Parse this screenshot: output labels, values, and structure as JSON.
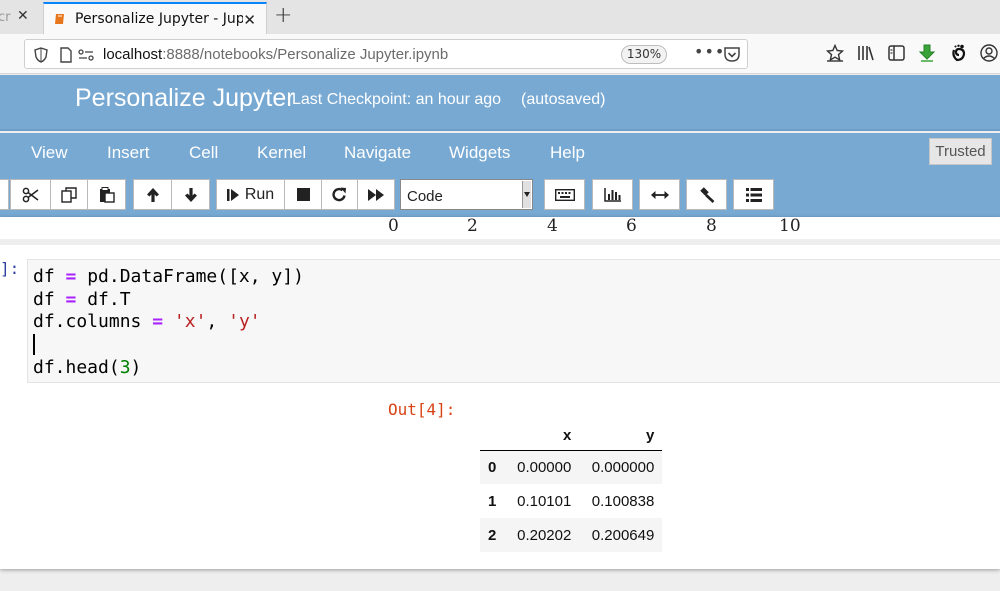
{
  "browser": {
    "prev_tab_title": "cr",
    "active_tab_title": "Personalize Jupyter - Jup",
    "url_host": "localhost",
    "url_rest": ":8888/notebooks/Personalize Jupyter.ipynb",
    "zoom": "130%",
    "dots": "•••",
    "toolbar_icons": [
      "star-icon",
      "library-icon",
      "sidebar-icon",
      "download-arrow-icon",
      "gnome-extension-icon",
      "account-icon"
    ]
  },
  "notebook": {
    "name": "Personalize Jupyter",
    "checkpoint": "Last Checkpoint: an hour ago",
    "autosave": "(autosaved)",
    "trusted": "Trusted",
    "menu": [
      "View",
      "Insert",
      "Cell",
      "Kernel",
      "Navigate",
      "Widgets",
      "Help"
    ],
    "toolbar": {
      "run_label": "Run",
      "cell_type": "Code",
      "icons": [
        "cut-icon",
        "copy-icon",
        "paste-icon",
        "move-up-icon",
        "move-down-icon",
        "run-icon",
        "stop-icon",
        "restart-icon",
        "fast-forward-icon",
        "keyboard-icon",
        "chart-icon",
        "arrows-h-icon",
        "gavel-icon",
        "list-icon"
      ]
    },
    "prev_plot_xticks": [
      "0",
      "2",
      "4",
      "6",
      "8",
      "10"
    ],
    "input_prompt": "]:",
    "output_prompt": "Out[4]:",
    "output_table": {
      "columns": [
        "x",
        "y"
      ],
      "rows": [
        {
          "index": "0",
          "x": "0.00000",
          "y": "0.000000"
        },
        {
          "index": "1",
          "x": "0.10101",
          "y": "0.100838"
        },
        {
          "index": "2",
          "x": "0.20202",
          "y": "0.200649"
        }
      ]
    }
  },
  "colors": {
    "jupyter_blue": "#78a9d3",
    "tab_accent": "#0a84ff",
    "in_prompt": "#303f9f",
    "out_prompt": "#d84315"
  }
}
